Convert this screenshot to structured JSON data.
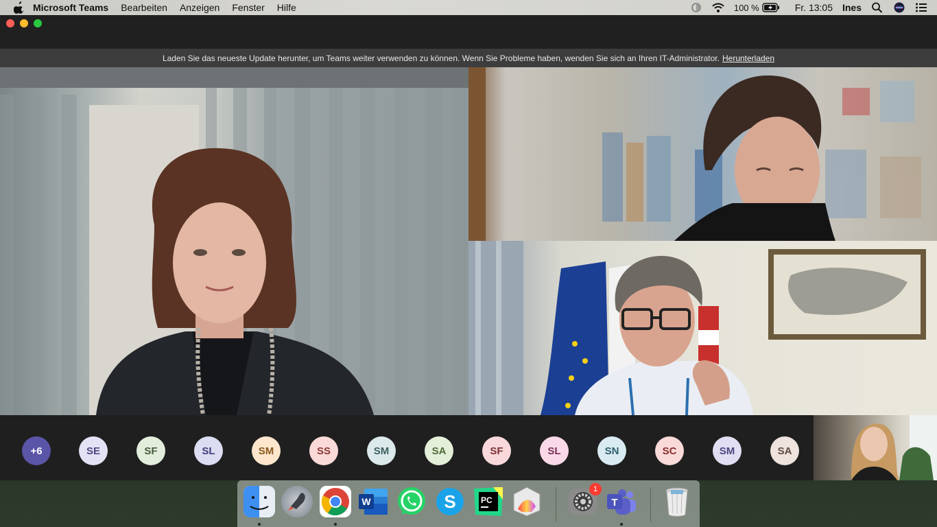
{
  "menubar": {
    "app_name": "Microsoft Teams",
    "menus": [
      "Bearbeiten",
      "Anzeigen",
      "Fenster",
      "Hilfe"
    ],
    "battery": "100 %",
    "clock": "Fr. 13:05",
    "user": "Ines"
  },
  "banner": {
    "message": "Laden Sie das neueste Update herunter, um Teams weiter verwenden zu können. Wenn Sie Probleme haben, wenden Sie sich an Ihren IT-Administrator.",
    "link": "Herunterladen"
  },
  "participants": [
    {
      "initials": "+6",
      "bg": "#5b55a8",
      "fg": "#ffffff"
    },
    {
      "initials": "SE",
      "bg": "#e3e2f5",
      "fg": "#4a4680"
    },
    {
      "initials": "SF",
      "bg": "#e2eddc",
      "fg": "#465c3e"
    },
    {
      "initials": "SL",
      "bg": "#dcdcf3",
      "fg": "#3f3f7a"
    },
    {
      "initials": "SM",
      "bg": "#fde6cc",
      "fg": "#8a5a1e"
    },
    {
      "initials": "SS",
      "bg": "#fadad8",
      "fg": "#8a3a36"
    },
    {
      "initials": "SM",
      "bg": "#dbe9ea",
      "fg": "#3f5f62"
    },
    {
      "initials": "SA",
      "bg": "#e3efd8",
      "fg": "#4e6a3a"
    },
    {
      "initials": "SF",
      "bg": "#f8d8da",
      "fg": "#7a3036"
    },
    {
      "initials": "SL",
      "bg": "#f9d9e8",
      "fg": "#7a2f56"
    },
    {
      "initials": "SN",
      "bg": "#d9ebf1",
      "fg": "#2f5f6f"
    },
    {
      "initials": "SC",
      "bg": "#fad9d9",
      "fg": "#8a2f2f"
    },
    {
      "initials": "SM",
      "bg": "#e1def3",
      "fg": "#4b4580"
    },
    {
      "initials": "SA",
      "bg": "#eee3dd",
      "fg": "#5e4a40"
    }
  ],
  "dock": {
    "items": [
      {
        "name": "finder",
        "color": "#3d8ff0"
      },
      {
        "name": "launchpad",
        "color": "#8a8f96"
      },
      {
        "name": "chrome",
        "color": "#ffffff"
      },
      {
        "name": "word",
        "color": "#2b5fb8"
      },
      {
        "name": "whatsapp",
        "color": "#25d366"
      },
      {
        "name": "skype",
        "color": "#1aa3e8"
      },
      {
        "name": "pycharm",
        "color": "#21d789"
      },
      {
        "name": "grapher",
        "color": "#d8d8d8"
      },
      {
        "name": "system-preferences",
        "color": "#7a7a7a",
        "badge": "1"
      },
      {
        "name": "teams",
        "color": "#5b5fc7"
      },
      {
        "name": "trash",
        "color": "#e0e0e0"
      }
    ]
  }
}
